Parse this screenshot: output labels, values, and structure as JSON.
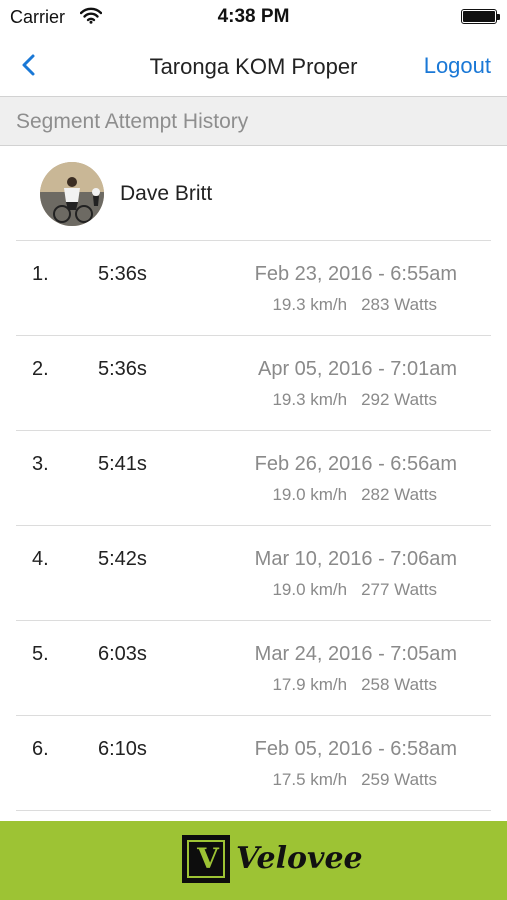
{
  "status_bar": {
    "carrier": "Carrier",
    "time": "4:38 PM"
  },
  "nav": {
    "title": "Taronga KOM Proper",
    "logout_label": "Logout"
  },
  "section_header": "Segment Attempt History",
  "profile": {
    "name": "Dave Britt"
  },
  "attempts": [
    {
      "rank": "1.",
      "time": "5:36s",
      "date": "Feb 23, 2016 - 6:55am",
      "speed": "19.3 km/h",
      "power": "283 Watts"
    },
    {
      "rank": "2.",
      "time": "5:36s",
      "date": "Apr 05, 2016 - 7:01am",
      "speed": "19.3 km/h",
      "power": "292 Watts"
    },
    {
      "rank": "3.",
      "time": "5:41s",
      "date": "Feb 26, 2016 - 6:56am",
      "speed": "19.0 km/h",
      "power": "282 Watts"
    },
    {
      "rank": "4.",
      "time": "5:42s",
      "date": "Mar 10, 2016 - 7:06am",
      "speed": "19.0 km/h",
      "power": "277 Watts"
    },
    {
      "rank": "5.",
      "time": "6:03s",
      "date": "Mar 24, 2016 - 7:05am",
      "speed": "17.9 km/h",
      "power": "258 Watts"
    },
    {
      "rank": "6.",
      "time": "6:10s",
      "date": "Feb 05, 2016 - 6:58am",
      "speed": "17.5 km/h",
      "power": "259 Watts"
    }
  ],
  "footer": {
    "logo_letter": "V",
    "logo_text": "Velovee"
  },
  "colors": {
    "accent": "#1a78d6",
    "footer_bg": "#9dc334",
    "muted_text": "#8a8a8a"
  },
  "icons": {
    "back": "chevron-left-icon",
    "wifi": "wifi-icon",
    "battery": "battery-icon"
  }
}
